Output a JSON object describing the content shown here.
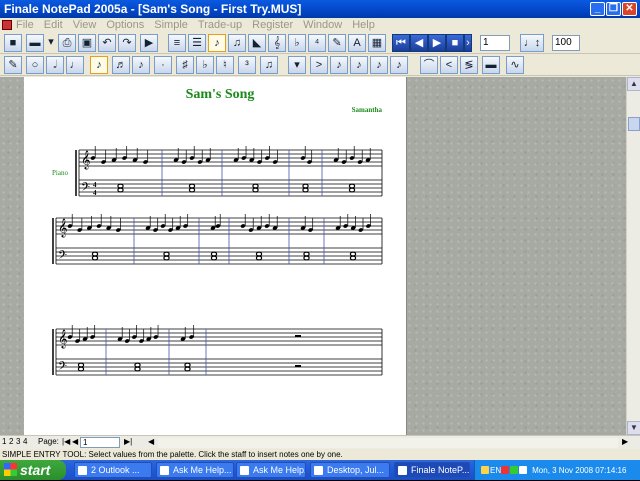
{
  "window": {
    "title": "Finale NotePad 2005a - [Sam's Song - First Try.MUS]",
    "controls": [
      "minimize",
      "restore",
      "close"
    ]
  },
  "menu": [
    "File",
    "Edit",
    "View",
    "Options",
    "Simple",
    "Trade-up",
    "Register",
    "Window",
    "Help"
  ],
  "toolbar1": {
    "icons": [
      "new-icon",
      "open-icon",
      "dropdown-icon",
      "print-icon",
      "save-icon",
      "undo-icon",
      "redo-icon",
      "speedy-icon",
      "scroll-view-icon",
      "page-view-icon",
      "simple-entry-icon",
      "speedy-entry-icon",
      "selection-icon",
      "staff-tool-icon",
      "clef-tool-icon",
      "key-sig-icon",
      "time-sig-icon",
      "text-tool-icon",
      "lyrics-icon"
    ],
    "playback": [
      "rewind-icon",
      "back-icon",
      "play-icon",
      "stop-icon",
      "forward-icon",
      "end-icon"
    ],
    "measure_value": "1",
    "tempo_value": "100"
  },
  "toolbar2": {
    "icons": [
      "eraser-icon",
      "whole-note-icon",
      "half-note-icon",
      "quarter-note-icon",
      "eighth-note-icon",
      "sixteenth-note-icon",
      "dot-icon",
      "tie-icon",
      "sharp-icon",
      "flat-icon",
      "natural-icon",
      "tuplet-icon",
      "rest-icon",
      "voice-icon",
      "accent-icon",
      "staccato-icon",
      "tenuto-icon",
      "fermata-icon",
      "marcato-icon",
      "slur-icon",
      "crescendo-icon",
      "decrescendo-icon",
      "hairpin-icon",
      "trill-icon"
    ]
  },
  "score": {
    "title": "Sam's Song",
    "composer": "Samantha",
    "instrument": "Piano"
  },
  "pager": {
    "pages": [
      "1",
      "2",
      "3",
      "4"
    ],
    "label": "Page:",
    "current": "1"
  },
  "status": "SIMPLE ENTRY TOOL: Select values from the palette. Click the staff to insert notes one by one.",
  "taskbar": {
    "start": "start",
    "tasks": [
      "2 Outlook ...",
      "Ask Me Help...",
      "Ask Me Help...",
      "Desktop, Jul...",
      "Finale NoteP..."
    ],
    "clock": "Mon, 3 Nov 2008 07:14:16",
    "lang": "EN"
  },
  "colors": {
    "title_green": "#1a8a1a",
    "titlebar_blue": "#0a5ae0",
    "taskbar_blue": "#245edc",
    "start_green": "#3ea83e"
  }
}
